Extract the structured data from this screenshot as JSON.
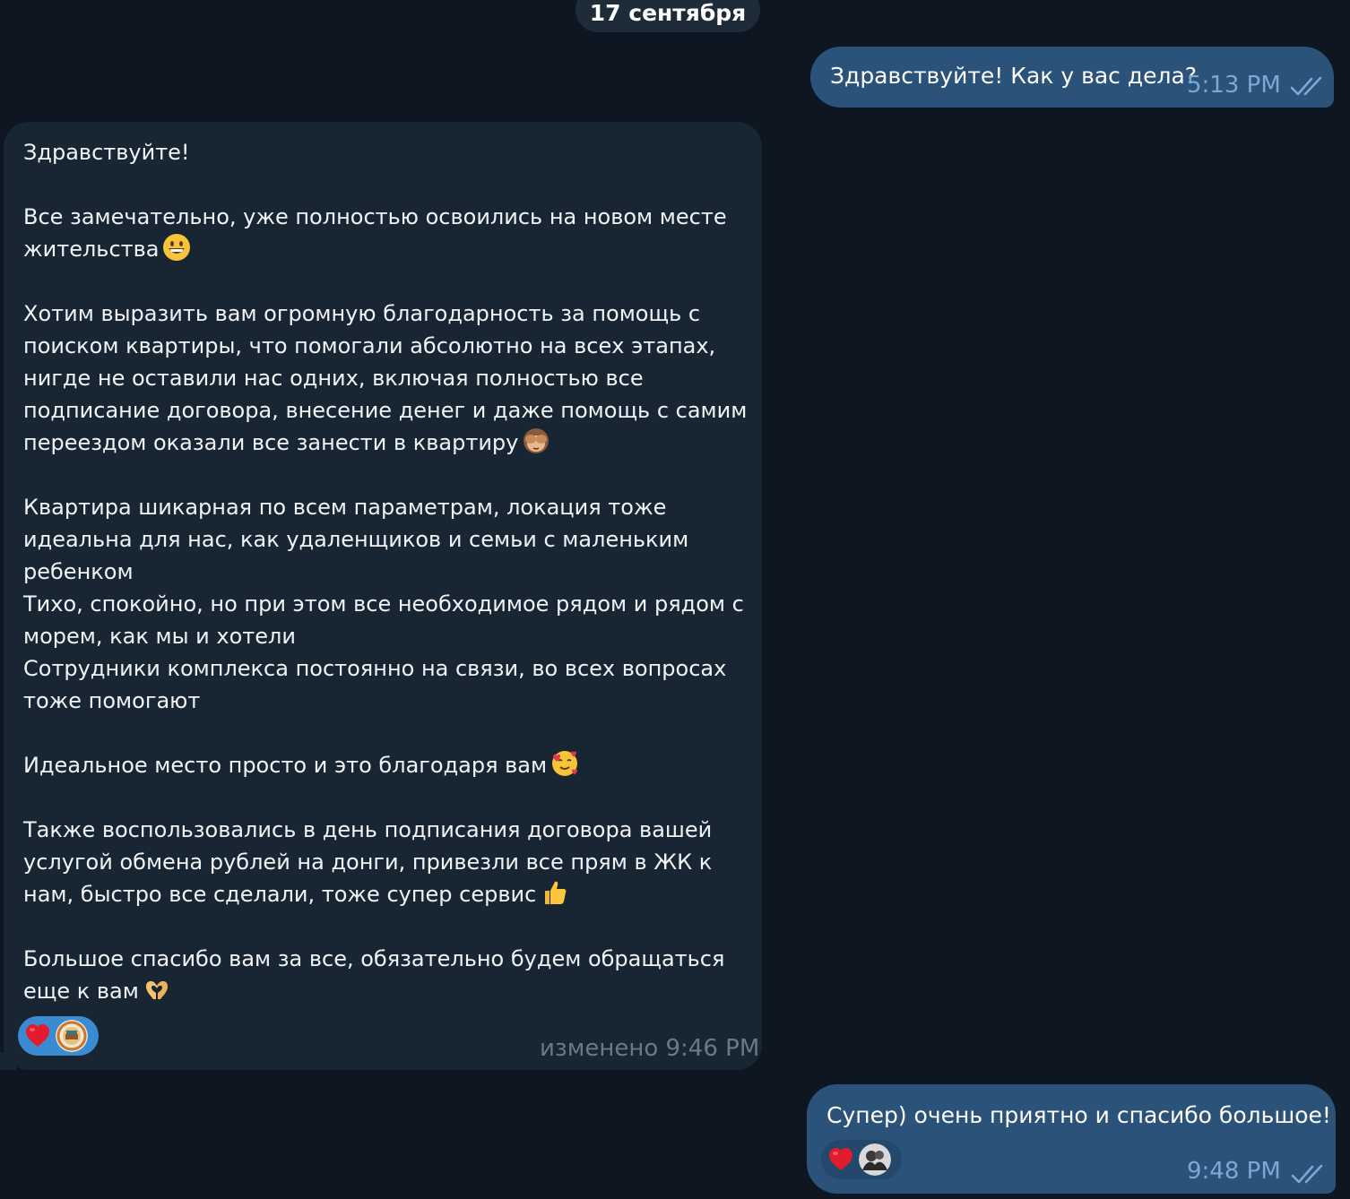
{
  "date_separator": "17 сентября",
  "messages": [
    {
      "direction": "outgoing",
      "text": "Здравствуйте! Как у вас дела?",
      "time": "5:13 PM",
      "status": "read"
    },
    {
      "direction": "incoming",
      "paragraphs": [
        [
          "Здравствуйте!"
        ],
        [
          "Все замечательно, уже полностью освоились на новом месте",
          "жительства"
        ],
        [
          "Хотим выразить вам огромную благодарность за помощь с",
          "поиском квартиры, что помогали абсолютно на всех этапах,",
          "нигде не оставили нас одних, включая полностью все",
          "подписание договора, внесение денег и даже помощь с самим",
          "переездом оказали все занести в квартиру"
        ],
        [
          "Квартира шикарная по всем параметрам, локация тоже",
          "идеальна для нас, как удаленщиков и семьи с маленьким",
          "ребенком",
          "Тихо, спокойно, но при этом все необходимое рядом и рядом с",
          "морем, как мы и хотели",
          "Сотрудники комплекса постоянно на связи, во всех вопросах",
          "тоже помогают"
        ],
        [
          "Идеальное место просто и это благодаря вам"
        ],
        [
          "Также воспользовались в день подписания договора вашей",
          "услугой обмена рублей на донги, привезли все прям в ЖК к",
          "нам, быстро все сделали, тоже супер сервис"
        ],
        [
          "Большое спасибо вам за все, обязательно будем обращаться",
          "еще к вам"
        ]
      ],
      "emojis": {
        "grin": "grinning-face-emoji",
        "monkey": "see-no-evil-monkey-emoji",
        "love": "smiling-face-with-hearts-emoji",
        "thumbs": "thumbs-up-emoji",
        "hands": "heart-hands-emoji"
      },
      "reaction": "heart",
      "edited_label": "изменено 9:46 PM"
    },
    {
      "direction": "outgoing",
      "text": "Супер) очень приятно и спасибо большое!",
      "reaction": "heart",
      "time": "9:48 PM",
      "status": "read"
    }
  ],
  "colors": {
    "background": "#0e1621",
    "outgoing_bubble": "#2b5278",
    "incoming_bubble": "#182533",
    "outgoing_meta": "#7da8d3",
    "incoming_meta": "#6c7883",
    "reaction_active": "#3a8bd1"
  }
}
